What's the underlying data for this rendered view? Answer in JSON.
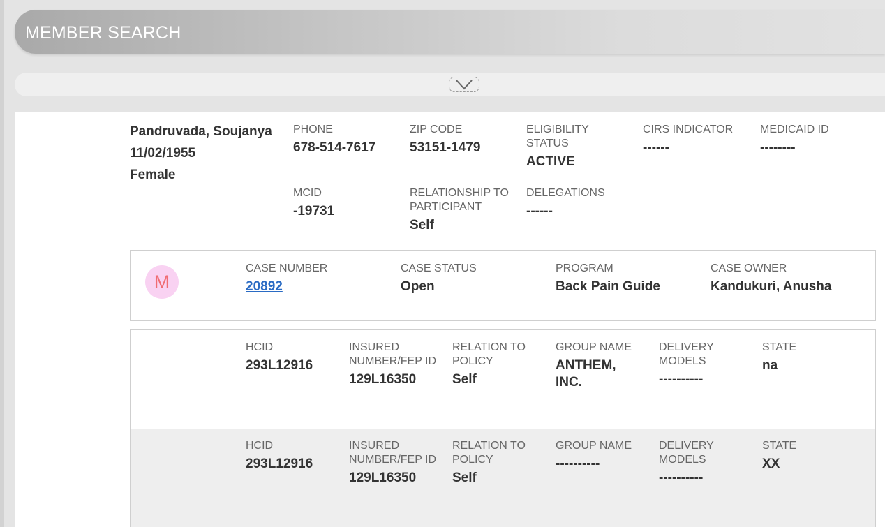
{
  "header": {
    "title": "MEMBER SEARCH"
  },
  "member": {
    "name": "Pandruvada, Soujanya",
    "dob": "11/02/1955",
    "gender": "Female",
    "fields": {
      "phone": {
        "label": "PHONE",
        "value": "678-514-7617"
      },
      "zip": {
        "label": "ZIP CODE",
        "value": "53151-1479"
      },
      "eligibility": {
        "label": "ELIGIBILITY STATUS",
        "value": "ACTIVE"
      },
      "cirs": {
        "label": "CIRS INDICATOR",
        "value": "------"
      },
      "medicaid": {
        "label": "MEDICAID ID",
        "value": "--------"
      },
      "mcid": {
        "label": "MCID",
        "value": "-19731"
      },
      "relationship": {
        "label": "RELATIONSHIP TO PARTICIPANT",
        "value": "Self"
      },
      "delegations": {
        "label": "DELEGATIONS",
        "value": "------"
      }
    }
  },
  "case": {
    "avatar_letter": "M",
    "case_number": {
      "label": "CASE NUMBER",
      "value": "20892"
    },
    "case_status": {
      "label": "CASE STATUS",
      "value": "Open"
    },
    "program": {
      "label": "PROGRAM",
      "value": "Back Pain Guide"
    },
    "case_owner": {
      "label": "CASE OWNER",
      "value": "Kandukuri, Anusha"
    }
  },
  "policies": [
    {
      "hcid": {
        "label": "HCID",
        "value": "293L12916"
      },
      "insured": {
        "label": "INSURED NUMBER/FEP ID",
        "value": "129L16350"
      },
      "relation": {
        "label": "RELATION TO POLICY",
        "value": "Self"
      },
      "group": {
        "label": "GROUP NAME",
        "value": "ANTHEM, INC."
      },
      "delivery": {
        "label": "DELIVERY MODELS",
        "value": "----------"
      },
      "state": {
        "label": "STATE",
        "value": "na"
      }
    },
    {
      "hcid": {
        "label": "HCID",
        "value": "293L12916"
      },
      "insured": {
        "label": "INSURED NUMBER/FEP ID",
        "value": "129L16350"
      },
      "relation": {
        "label": "RELATION TO POLICY",
        "value": "Self"
      },
      "group": {
        "label": "GROUP NAME",
        "value": "----------"
      },
      "delivery": {
        "label": "DELIVERY MODELS",
        "value": "----------"
      },
      "state": {
        "label": "STATE",
        "value": "XX"
      }
    }
  ],
  "icons": {
    "toggle": "chevron-down-icon",
    "avatar": "member-avatar-icon"
  },
  "colors": {
    "link": "#2a6bc4",
    "avatar_bg": "#f9d2f2",
    "avatar_text": "#f06c73"
  }
}
